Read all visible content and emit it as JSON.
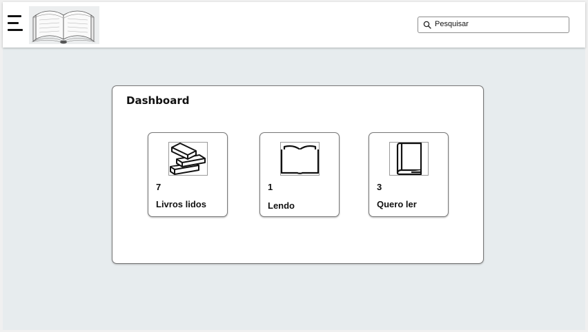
{
  "header": {
    "menu_icon": "hamburger-menu-icon",
    "logo_icon": "open-book-logo",
    "search": {
      "placeholder": "Pesquisar",
      "value": "",
      "icon": "search-icon"
    }
  },
  "dashboard": {
    "title": "Dashboard",
    "cards": [
      {
        "count": "7",
        "label": "Livros lidos",
        "icon": "book-stack-icon"
      },
      {
        "count": "1",
        "label": "Lendo",
        "icon": "open-book-icon"
      },
      {
        "count": "3",
        "label": "Quero ler",
        "icon": "closed-book-icon"
      }
    ]
  }
}
